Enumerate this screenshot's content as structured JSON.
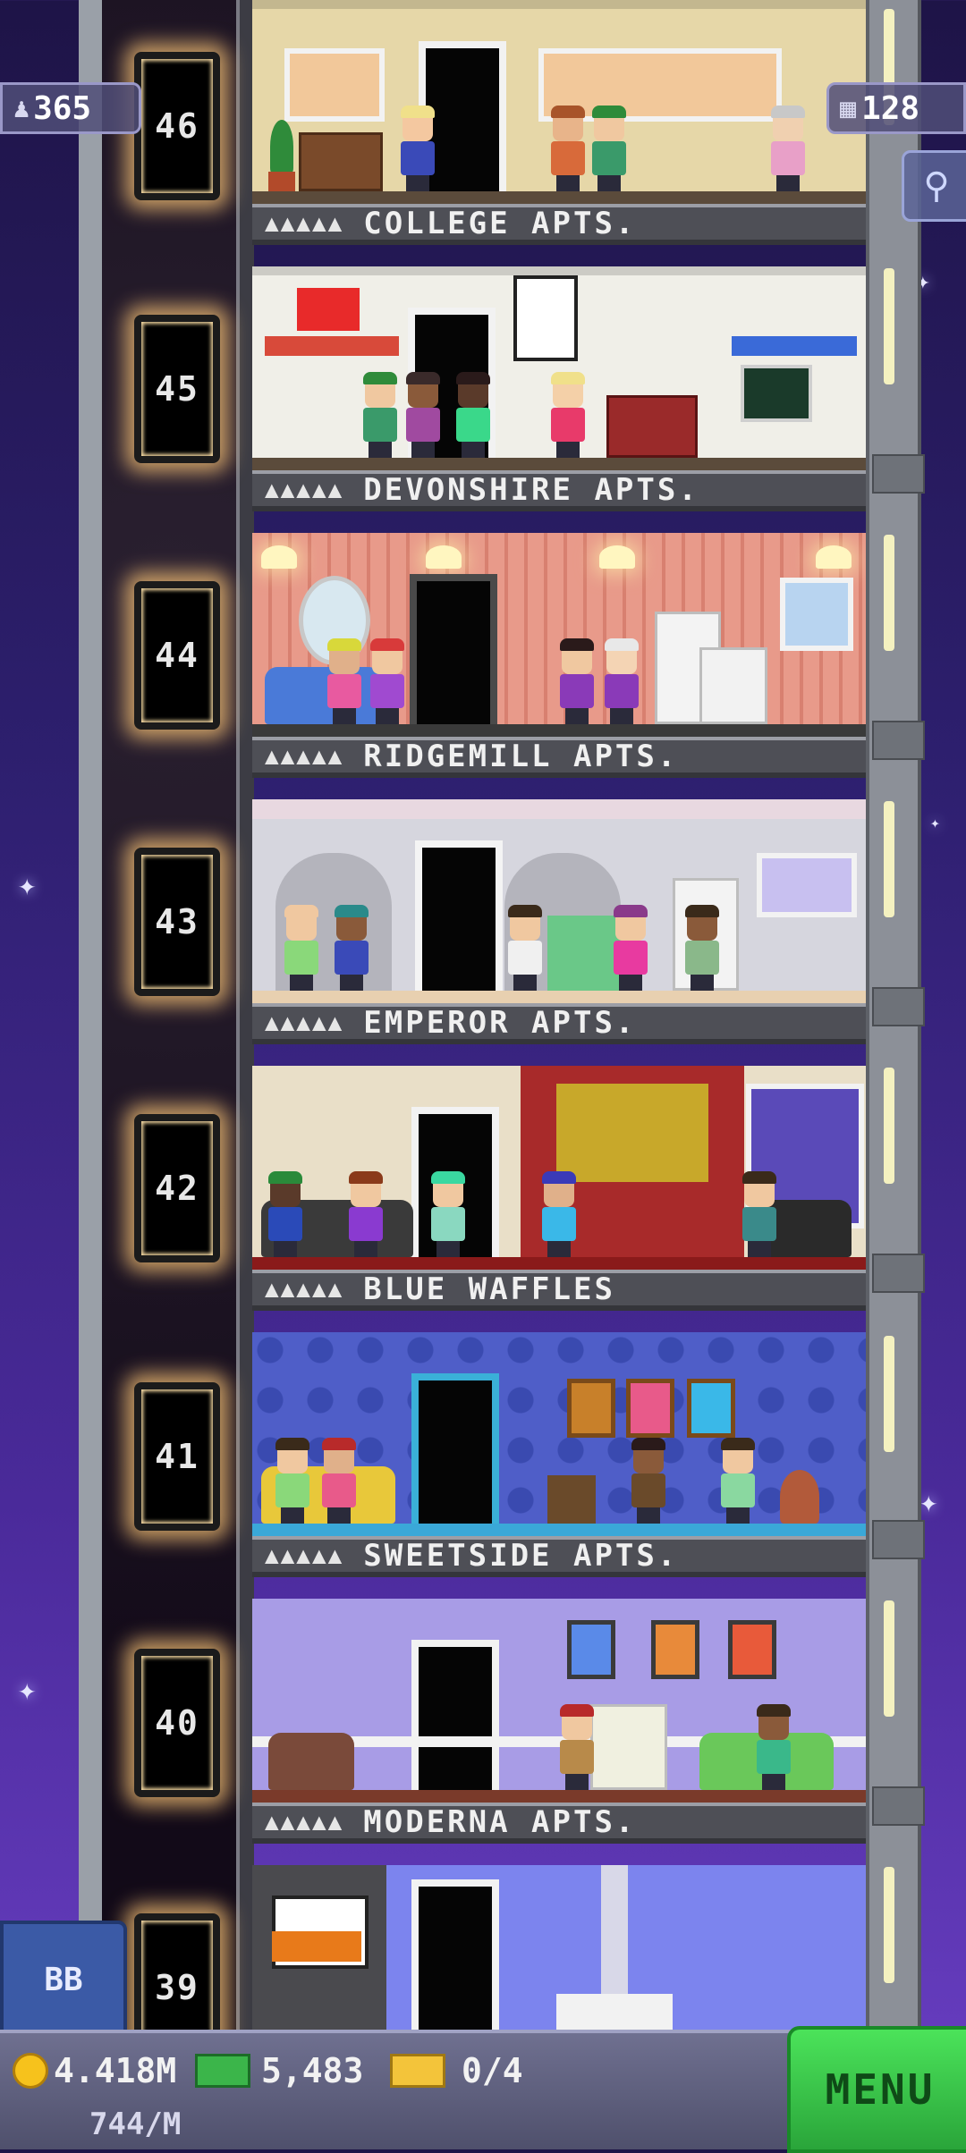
{
  "hud": {
    "population": "365",
    "floors": "128"
  },
  "floors": [
    {
      "number": "46",
      "name": "COLLEGE APTS.",
      "wall": "#e6d7a8",
      "occupancy": "▲▲▲▲▲"
    },
    {
      "number": "45",
      "name": "DEVONSHIRE APTS.",
      "wall": "#f0efe8",
      "occupancy": "▲▲▲▲▲"
    },
    {
      "number": "44",
      "name": "RIDGEMILL APTS.",
      "wall": "#e89a8a",
      "occupancy": "▲▲▲▲▲"
    },
    {
      "number": "43",
      "name": "EMPEROR APTS.",
      "wall": "#d6d6de",
      "occupancy": "▲▲▲▲▲"
    },
    {
      "number": "42",
      "name": "BLUE WAFFLES",
      "wall": "#e9dfc8",
      "occupancy": "▲▲▲▲▲"
    },
    {
      "number": "41",
      "name": "SWEETSIDE APTS.",
      "wall": "#4f5ec8",
      "occupancy": "▲▲▲▲▲"
    },
    {
      "number": "40",
      "name": "MODERNA APTS.",
      "wall": "#a89ce6",
      "occupancy": "▲▲▲▲▲"
    },
    {
      "number": "39",
      "name": "",
      "wall": "#7c84ee",
      "occupancy": ""
    }
  ],
  "bottom": {
    "coins": "4.418M",
    "coin_rate": "744/M",
    "bux": "5,483",
    "tickets": "0/4",
    "menu_label": "MENU",
    "bb_label": "BB"
  },
  "icons": {
    "population": "person-icon",
    "floors": "building-icon",
    "search": "magnifier-icon",
    "coins": "coin-icon",
    "bux": "tower-bux-icon",
    "tickets": "ticket-icon"
  },
  "colors": {
    "menu_green": "#2aa53a",
    "hud_pill": "#505078",
    "door_glow": "#ffc878"
  }
}
